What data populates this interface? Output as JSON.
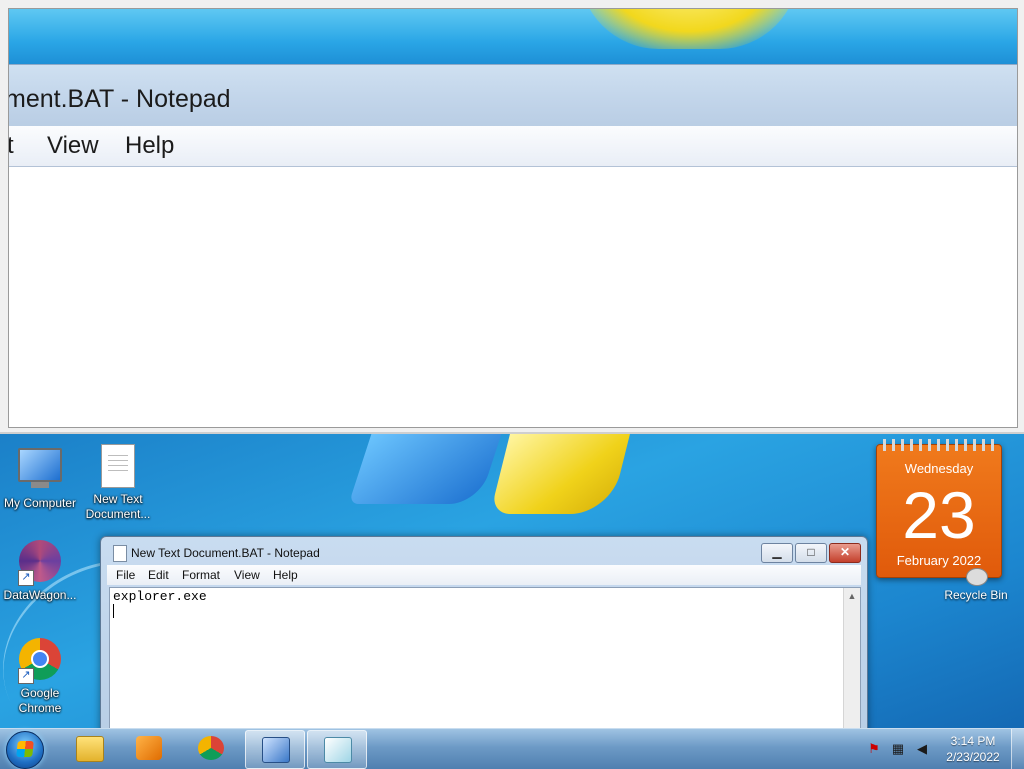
{
  "magnifier": {
    "title_fragment": "ment.BAT - Notepad",
    "menu": [
      "t",
      "View",
      "Help"
    ]
  },
  "desktop": {
    "icons": [
      {
        "label_line1": "My Computer",
        "label_line2": ""
      },
      {
        "label_line1": "New Text",
        "label_line2": "Document..."
      },
      {
        "label_line1": "DataWagon...",
        "label_line2": ""
      },
      {
        "label_line1": "Google",
        "label_line2": "Chrome"
      }
    ],
    "recycle_bin": "Recycle Bin"
  },
  "calendar_gadget": {
    "weekday": "Wednesday",
    "day": "23",
    "month_year": "February 2022",
    "color": "#e8660f"
  },
  "notepad": {
    "title": "New Text Document.BAT - Notepad",
    "menu": [
      "File",
      "Edit",
      "Format",
      "View",
      "Help"
    ],
    "content": "explorer.exe",
    "controls": {
      "minimize": "▁",
      "maximize": "□",
      "close": "✕"
    }
  },
  "taskbar": {
    "pinned": [
      "folder-icon",
      "media-player-icon",
      "chrome-icon",
      "magnifier-icon",
      "notepad-icon"
    ],
    "active_index": 4,
    "tray_icons": [
      "action-center-icon",
      "network-icon",
      "volume-icon"
    ],
    "time": "3:14 PM",
    "date": "2/23/2022"
  }
}
